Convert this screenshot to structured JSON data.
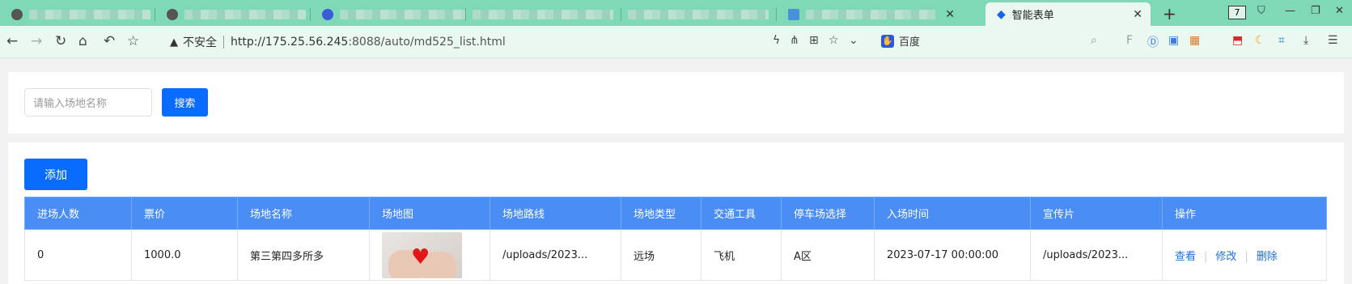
{
  "browser": {
    "active_tab": {
      "title": "智能表单"
    },
    "new_tab": "+",
    "tab_count": "7",
    "url_warning": "不安全",
    "url_host": "http://175.25.56.245",
    "url_path": ":8088/auto/md525_list.html",
    "search_engine": "百度"
  },
  "search": {
    "placeholder": "请输入场地名称",
    "button": "搜索"
  },
  "toolbar": {
    "add_button": "添加"
  },
  "table": {
    "headers": [
      "进场人数",
      "票价",
      "场地名称",
      "场地图",
      "场地路线",
      "场地类型",
      "交通工具",
      "停车场选择",
      "入场时间",
      "宣传片",
      "操作"
    ],
    "rows": [
      {
        "people": "0",
        "price": "1000.0",
        "name": "第三第四多所多",
        "route": "/uploads/2023...",
        "type": "远场",
        "transport": "飞机",
        "parking": "A区",
        "time": "2023-07-17 00:00:00",
        "promo": "/uploads/2023...",
        "actions": {
          "view": "查看",
          "edit": "修改",
          "delete": "删除"
        }
      }
    ]
  }
}
